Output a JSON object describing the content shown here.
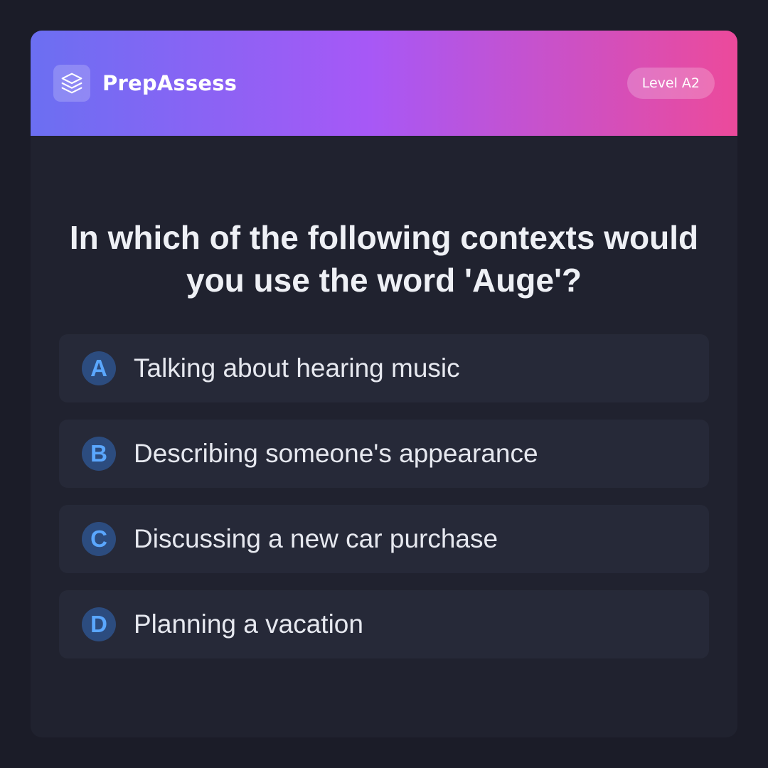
{
  "header": {
    "logo_icon": "layers-icon",
    "brand": "PrepAssess",
    "level": "Level A2",
    "gradient_colors": [
      "#6b6ff2",
      "#a758f6",
      "#ec4a9b"
    ]
  },
  "question": {
    "text": "In which of the following contexts would you use the word 'Auge'?"
  },
  "options": [
    {
      "letter": "A",
      "text": "Talking about hearing music"
    },
    {
      "letter": "B",
      "text": "Describing someone's appearance"
    },
    {
      "letter": "C",
      "text": "Discussing a new car purchase"
    },
    {
      "letter": "D",
      "text": "Planning a vacation"
    }
  ],
  "colors": {
    "page_background": "#1b1c28",
    "card_background": "#20222f",
    "option_background": "#262938",
    "letter_badge_background": "#2c4c7f",
    "letter_color": "#5aa7ff"
  }
}
